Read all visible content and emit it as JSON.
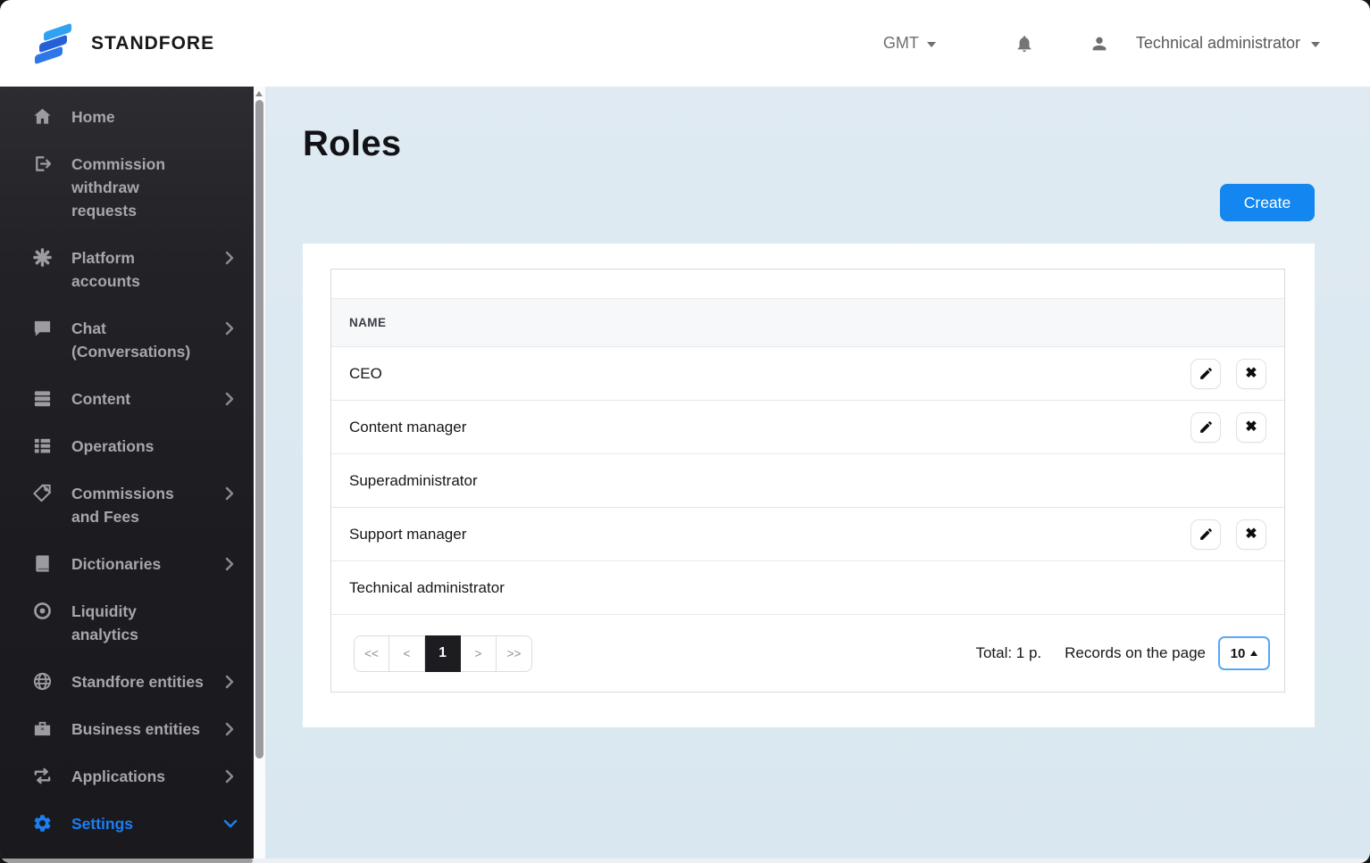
{
  "header": {
    "brand": "STANDFORE",
    "timezone": "GMT",
    "user": "Technical administrator"
  },
  "sidebar": {
    "items": [
      {
        "label": "Home",
        "icon": "home-icon",
        "expandable": false
      },
      {
        "label": "Commission withdraw requests",
        "icon": "withdraw-icon",
        "expandable": false
      },
      {
        "label": "Platform accounts",
        "icon": "platform-accounts-icon",
        "expandable": true
      },
      {
        "label": "Chat (Conversations)",
        "icon": "chat-icon",
        "expandable": true
      },
      {
        "label": "Content",
        "icon": "content-icon",
        "expandable": true
      },
      {
        "label": "Operations",
        "icon": "operations-icon",
        "expandable": false
      },
      {
        "label": "Commissions and Fees",
        "icon": "commissions-icon",
        "expandable": true
      },
      {
        "label": "Dictionaries",
        "icon": "dictionaries-icon",
        "expandable": true
      },
      {
        "label": "Liquidity analytics",
        "icon": "liquidity-icon",
        "expandable": false
      },
      {
        "label": "Standfore entities",
        "icon": "standfore-entities-icon",
        "expandable": true
      },
      {
        "label": "Business entities",
        "icon": "business-entities-icon",
        "expandable": true
      },
      {
        "label": "Applications",
        "icon": "applications-icon",
        "expandable": true
      },
      {
        "label": "Settings",
        "icon": "settings-icon",
        "expandable": true,
        "active": true,
        "expanded": true
      }
    ]
  },
  "main": {
    "title": "Roles",
    "create_label": "Create",
    "table": {
      "columns": [
        "NAME"
      ],
      "rows": [
        {
          "name": "CEO",
          "actions": true
        },
        {
          "name": "Content manager",
          "actions": true
        },
        {
          "name": "Superadministrator",
          "actions": false
        },
        {
          "name": "Support manager",
          "actions": true
        },
        {
          "name": "Technical administrator",
          "actions": false
        }
      ]
    },
    "pagination": {
      "first": "<<",
      "prev": "<",
      "page": "1",
      "next": ">",
      "last": ">>",
      "total": "Total: 1 p.",
      "records_label": "Records on the page",
      "page_size": "10"
    }
  },
  "colors": {
    "accent": "#1386f0",
    "sidebar_active": "#1b7ef2",
    "main_bg": "#dce8f1",
    "pagination_active_bg": "#1d1d21"
  }
}
